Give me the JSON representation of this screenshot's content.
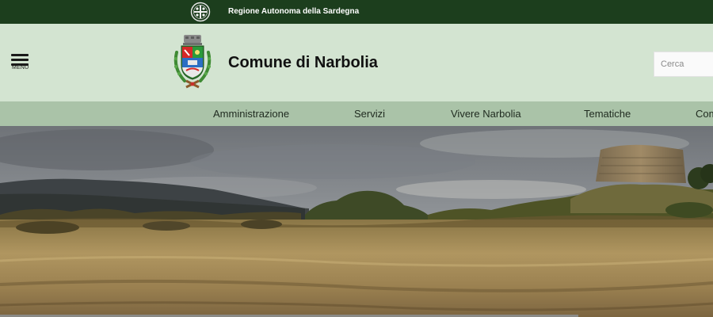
{
  "topbar": {
    "region_name": "Regione Autonoma della Sardegna",
    "emblem_icon": "sardinia-emblem-icon",
    "bg": "#1c3e1d"
  },
  "header": {
    "menu_label": "MENU",
    "site_title": "Comune di Narbolia",
    "crest_icon": "municipal-crest-icon",
    "search_placeholder": "Cerca",
    "bg": "#d3e4d1"
  },
  "nav": {
    "bg": "#aac3a8",
    "items": [
      {
        "label": "Amministrazione"
      },
      {
        "label": "Servizi"
      },
      {
        "label": "Vivere Narbolia"
      },
      {
        "label": "Tematiche"
      },
      {
        "label": "Com"
      }
    ]
  },
  "hero": {
    "image": "landscape-nuraghe-photo"
  }
}
